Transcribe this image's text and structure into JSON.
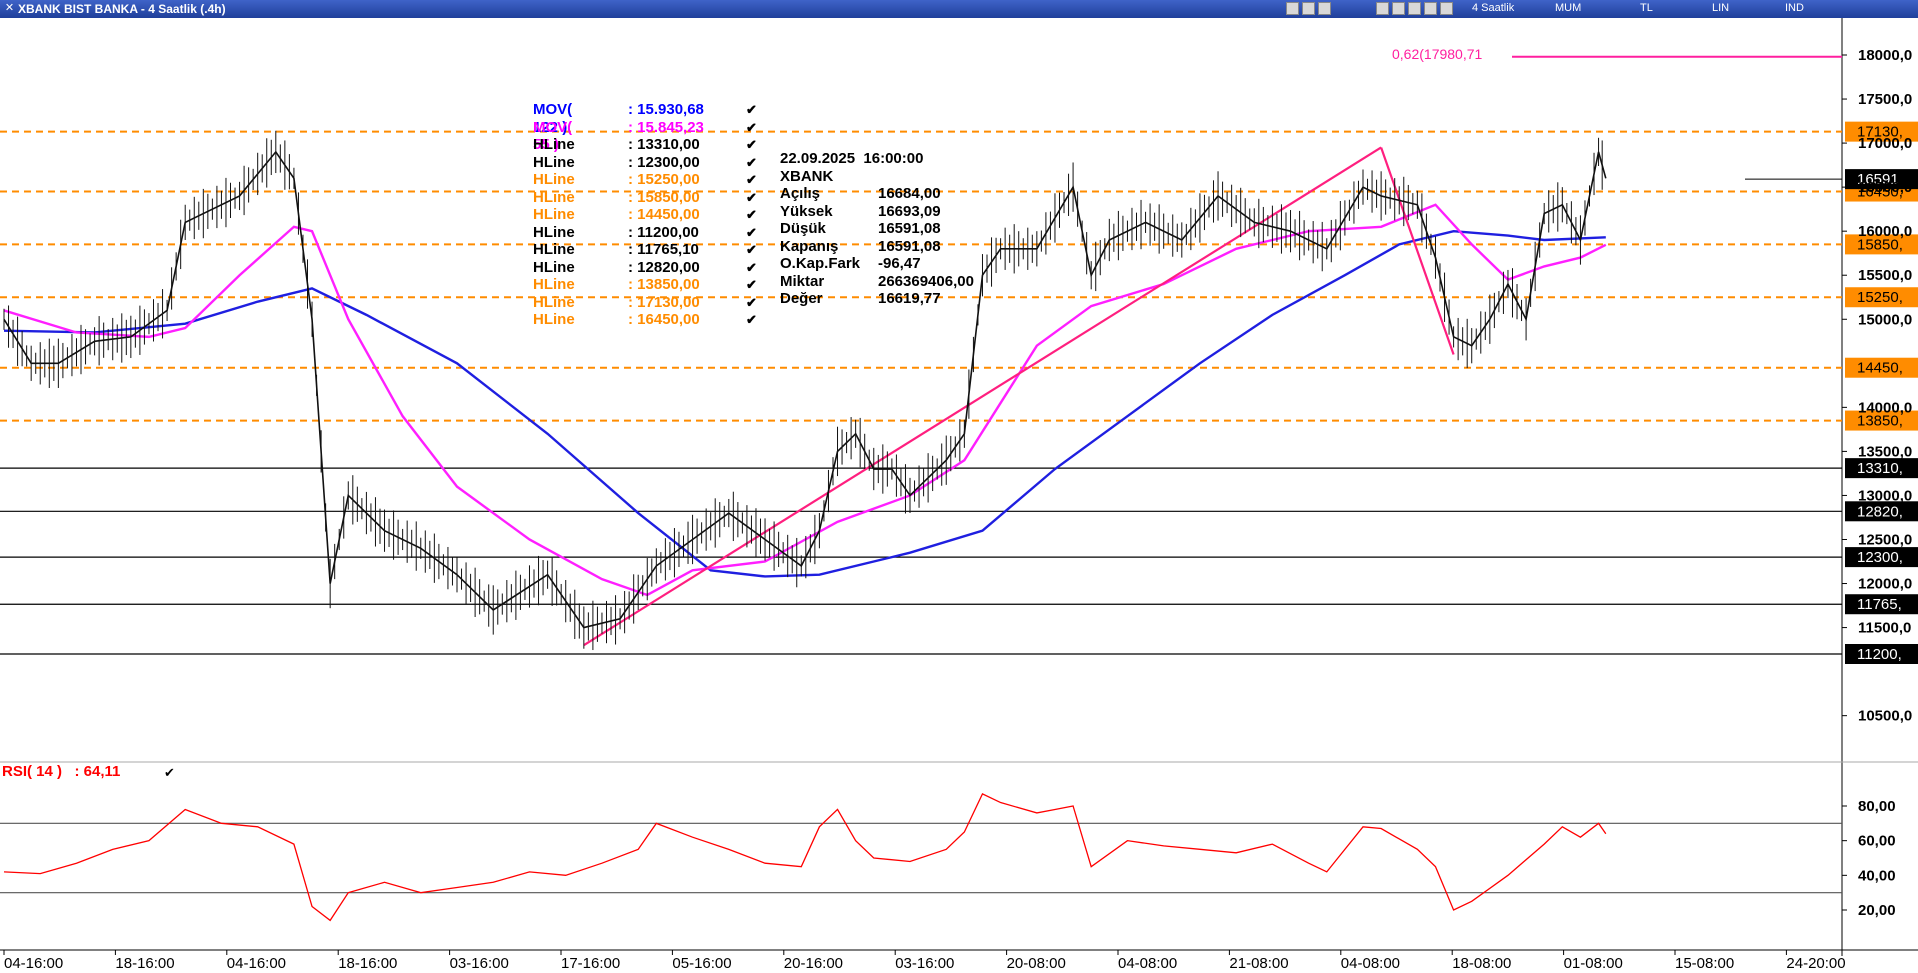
{
  "window": {
    "title": "XBANK BIST BANKA - 4 Saatlik (.4h)",
    "toolbar": {
      "period": "4 Saatlik",
      "chart_type": "MUM",
      "currency": "TL",
      "scale": "LIN",
      "mode": "IND"
    }
  },
  "legend": [
    {
      "name": "MOV( 122 )",
      "value": ": 15.930,68",
      "color": "#0000ff"
    },
    {
      "name": "MOV( 55 )",
      "value": ": 15.845,23",
      "color": "#ff00ff"
    },
    {
      "name": "HLine",
      "value": ": 13310,00",
      "color": "#000000"
    },
    {
      "name": "HLine",
      "value": ": 12300,00",
      "color": "#000000"
    },
    {
      "name": "HLine",
      "value": ": 15250,00",
      "color": "#ff8c00"
    },
    {
      "name": "HLine",
      "value": ": 15850,00",
      "color": "#ff8c00"
    },
    {
      "name": "HLine",
      "value": ": 14450,00",
      "color": "#ff8c00"
    },
    {
      "name": "HLine",
      "value": ": 11200,00",
      "color": "#000000"
    },
    {
      "name": "HLine",
      "value": ": 11765,10",
      "color": "#000000"
    },
    {
      "name": "HLine",
      "value": ": 12820,00",
      "color": "#000000"
    },
    {
      "name": "HLine",
      "value": ": 13850,00",
      "color": "#ff8c00"
    },
    {
      "name": "HLine",
      "value": ": 17130,00",
      "color": "#ff8c00"
    },
    {
      "name": "HLine",
      "value": ": 16450,00",
      "color": "#ff8c00"
    }
  ],
  "info_box": {
    "datetime": "22.09.2025  16:00:00",
    "symbol": "XBANK",
    "rows": [
      {
        "label": "Açılış",
        "value": "16684,00"
      },
      {
        "label": "Yüksek",
        "value": "16693,09"
      },
      {
        "label": "Düşük",
        "value": "16591,08"
      },
      {
        "label": "Kapanış",
        "value": "16591,08"
      },
      {
        "label": "O.Kap.Fark",
        "value": "-96,47"
      },
      {
        "label": "Miktar",
        "value": "266369406,00"
      },
      {
        "label": "Değer",
        "value": "16619,77"
      }
    ]
  },
  "fib_label": "0,62(17980,71",
  "rsi_label": "RSI( 14 )   : 64,11",
  "chart_data": {
    "type": "line",
    "title": "XBANK BIST BANKA - 4 Saatlik (.4h)",
    "price_axis": {
      "ticks": [
        "18000,0",
        "17500,0",
        "17000,0",
        "16500,0",
        "16000,0",
        "15500,0",
        "15000,0",
        "14000,0",
        "13500,0",
        "13000,0",
        "12500,0",
        "12000,0",
        "11500,0",
        "10500,0"
      ],
      "range": [
        10200,
        18150
      ]
    },
    "x_labels": [
      "04-16:00",
      "18-16:00",
      "04-16:00",
      "18-16:00",
      "03-16:00",
      "17-16:00",
      "05-16:00",
      "20-16:00",
      "03-16:00",
      "20-08:00",
      "04-08:00",
      "21-08:00",
      "04-08:00",
      "18-08:00",
      "01-08:00",
      "15-08:00",
      "24-20:00"
    ],
    "hlines": [
      {
        "value": 17130,
        "label": "17130,",
        "style": "dashed",
        "color": "#ff8c00"
      },
      {
        "value": 16450,
        "label": "16450,",
        "style": "dashed",
        "color": "#ff8c00"
      },
      {
        "value": 15850,
        "label": "15850,",
        "style": "dashed",
        "color": "#ff8c00"
      },
      {
        "value": 15250,
        "label": "15250,",
        "style": "dashed",
        "color": "#ff8c00"
      },
      {
        "value": 14450,
        "label": "14450,",
        "style": "dashed",
        "color": "#ff8c00"
      },
      {
        "value": 13850,
        "label": "13850,",
        "style": "dashed",
        "color": "#ff8c00"
      },
      {
        "value": 13310,
        "label": "13310,",
        "style": "solid",
        "color": "#000000"
      },
      {
        "value": 12820,
        "label": "12820,",
        "style": "solid",
        "color": "#000000"
      },
      {
        "value": 12300,
        "label": "12300,",
        "style": "solid",
        "color": "#000000"
      },
      {
        "value": 11765,
        "label": "11765,",
        "style": "solid",
        "color": "#000000"
      },
      {
        "value": 11200,
        "label": "11200,",
        "style": "solid",
        "color": "#000000"
      }
    ],
    "last_price": {
      "value": 16591,
      "label": "16591"
    },
    "fib_level": {
      "value": 17980.71
    },
    "price_series": [
      {
        "x": 0,
        "y": 15000
      },
      {
        "x": 1.5,
        "y": 14500
      },
      {
        "x": 3,
        "y": 14500
      },
      {
        "x": 5,
        "y": 14750
      },
      {
        "x": 7,
        "y": 14800
      },
      {
        "x": 9,
        "y": 15100
      },
      {
        "x": 10,
        "y": 16100
      },
      {
        "x": 11,
        "y": 16200
      },
      {
        "x": 13,
        "y": 16400
      },
      {
        "x": 15,
        "y": 16900
      },
      {
        "x": 16,
        "y": 16600
      },
      {
        "x": 17,
        "y": 15000
      },
      {
        "x": 18,
        "y": 12000
      },
      {
        "x": 19,
        "y": 13000
      },
      {
        "x": 21,
        "y": 12600
      },
      {
        "x": 23,
        "y": 12400
      },
      {
        "x": 25,
        "y": 12100
      },
      {
        "x": 27,
        "y": 11700
      },
      {
        "x": 30,
        "y": 12100
      },
      {
        "x": 32,
        "y": 11500
      },
      {
        "x": 34,
        "y": 11600
      },
      {
        "x": 36,
        "y": 12200
      },
      {
        "x": 38,
        "y": 12500
      },
      {
        "x": 40,
        "y": 12800
      },
      {
        "x": 42,
        "y": 12500
      },
      {
        "x": 44,
        "y": 12200
      },
      {
        "x": 45,
        "y": 12600
      },
      {
        "x": 46,
        "y": 13500
      },
      {
        "x": 47,
        "y": 13700
      },
      {
        "x": 48,
        "y": 13300
      },
      {
        "x": 49,
        "y": 13300
      },
      {
        "x": 50,
        "y": 13000
      },
      {
        "x": 52,
        "y": 13400
      },
      {
        "x": 53,
        "y": 13700
      },
      {
        "x": 54,
        "y": 15500
      },
      {
        "x": 55,
        "y": 15800
      },
      {
        "x": 57,
        "y": 15800
      },
      {
        "x": 59,
        "y": 16500
      },
      {
        "x": 60,
        "y": 15500
      },
      {
        "x": 61,
        "y": 15900
      },
      {
        "x": 63,
        "y": 16100
      },
      {
        "x": 65,
        "y": 15900
      },
      {
        "x": 67,
        "y": 16400
      },
      {
        "x": 69,
        "y": 16100
      },
      {
        "x": 71,
        "y": 16000
      },
      {
        "x": 73,
        "y": 15800
      },
      {
        "x": 75,
        "y": 16500
      },
      {
        "x": 76,
        "y": 16400
      },
      {
        "x": 78,
        "y": 16300
      },
      {
        "x": 79,
        "y": 15700
      },
      {
        "x": 80,
        "y": 14800
      },
      {
        "x": 81,
        "y": 14700
      },
      {
        "x": 82,
        "y": 15000
      },
      {
        "x": 83,
        "y": 15400
      },
      {
        "x": 84,
        "y": 15000
      },
      {
        "x": 85,
        "y": 16200
      },
      {
        "x": 86,
        "y": 16300
      },
      {
        "x": 87,
        "y": 15900
      },
      {
        "x": 88,
        "y": 16900
      },
      {
        "x": 88.4,
        "y": 16600
      }
    ],
    "series": [
      {
        "name": "MOV( 122 )",
        "color": "#1f1fe0",
        "values": [
          {
            "x": 0,
            "y": 14870
          },
          {
            "x": 5,
            "y": 14850
          },
          {
            "x": 10,
            "y": 14950
          },
          {
            "x": 14,
            "y": 15200
          },
          {
            "x": 17,
            "y": 15350
          },
          {
            "x": 20,
            "y": 15050
          },
          {
            "x": 25,
            "y": 14500
          },
          {
            "x": 30,
            "y": 13700
          },
          {
            "x": 35,
            "y": 12800
          },
          {
            "x": 39,
            "y": 12150
          },
          {
            "x": 42,
            "y": 12080
          },
          {
            "x": 45,
            "y": 12100
          },
          {
            "x": 50,
            "y": 12350
          },
          {
            "x": 54,
            "y": 12600
          },
          {
            "x": 58,
            "y": 13300
          },
          {
            "x": 62,
            "y": 13900
          },
          {
            "x": 66,
            "y": 14500
          },
          {
            "x": 70,
            "y": 15050
          },
          {
            "x": 74,
            "y": 15500
          },
          {
            "x": 77,
            "y": 15850
          },
          {
            "x": 80,
            "y": 16000
          },
          {
            "x": 83,
            "y": 15950
          },
          {
            "x": 85,
            "y": 15900
          },
          {
            "x": 88.4,
            "y": 15930
          }
        ]
      },
      {
        "name": "MOV( 55 )",
        "color": "#ff1fff",
        "values": [
          {
            "x": 0,
            "y": 15100
          },
          {
            "x": 4,
            "y": 14850
          },
          {
            "x": 8,
            "y": 14800
          },
          {
            "x": 10,
            "y": 14900
          },
          {
            "x": 13,
            "y": 15500
          },
          {
            "x": 16,
            "y": 16050
          },
          {
            "x": 17,
            "y": 16000
          },
          {
            "x": 19,
            "y": 15000
          },
          {
            "x": 22,
            "y": 13900
          },
          {
            "x": 25,
            "y": 13100
          },
          {
            "x": 29,
            "y": 12500
          },
          {
            "x": 33,
            "y": 12050
          },
          {
            "x": 35.5,
            "y": 11870
          },
          {
            "x": 38,
            "y": 12150
          },
          {
            "x": 42,
            "y": 12250
          },
          {
            "x": 46,
            "y": 12700
          },
          {
            "x": 50,
            "y": 13000
          },
          {
            "x": 53,
            "y": 13400
          },
          {
            "x": 55,
            "y": 14050
          },
          {
            "x": 57,
            "y": 14700
          },
          {
            "x": 60,
            "y": 15150
          },
          {
            "x": 64,
            "y": 15400
          },
          {
            "x": 68,
            "y": 15800
          },
          {
            "x": 72,
            "y": 16000
          },
          {
            "x": 76,
            "y": 16050
          },
          {
            "x": 79,
            "y": 16300
          },
          {
            "x": 81,
            "y": 15850
          },
          {
            "x": 83,
            "y": 15450
          },
          {
            "x": 85,
            "y": 15600
          },
          {
            "x": 87,
            "y": 15700
          },
          {
            "x": 88.4,
            "y": 15845
          }
        ]
      }
    ],
    "trendlines": [
      {
        "x1": 32,
        "y1": 11300,
        "x2": 76,
        "y2": 16950
      },
      {
        "x1": 76,
        "y1": 16950,
        "x2": 80,
        "y2": 14600
      }
    ],
    "rsi": {
      "name": "RSI( 14 )",
      "ticks": [
        "80,00",
        "60,00",
        "40,00",
        "20,00"
      ],
      "levels": [
        70,
        30
      ],
      "range": [
        5,
        95
      ],
      "values": [
        {
          "x": 0,
          "y": 42
        },
        {
          "x": 2,
          "y": 41
        },
        {
          "x": 4,
          "y": 47
        },
        {
          "x": 6,
          "y": 55
        },
        {
          "x": 8,
          "y": 60
        },
        {
          "x": 10,
          "y": 78
        },
        {
          "x": 12,
          "y": 70
        },
        {
          "x": 14,
          "y": 68
        },
        {
          "x": 16,
          "y": 58
        },
        {
          "x": 17,
          "y": 22
        },
        {
          "x": 18,
          "y": 14
        },
        {
          "x": 19,
          "y": 30
        },
        {
          "x": 21,
          "y": 36
        },
        {
          "x": 23,
          "y": 30
        },
        {
          "x": 25,
          "y": 33
        },
        {
          "x": 27,
          "y": 36
        },
        {
          "x": 29,
          "y": 42
        },
        {
          "x": 31,
          "y": 40
        },
        {
          "x": 33,
          "y": 47
        },
        {
          "x": 35,
          "y": 55
        },
        {
          "x": 36,
          "y": 70
        },
        {
          "x": 38,
          "y": 62
        },
        {
          "x": 40,
          "y": 55
        },
        {
          "x": 42,
          "y": 47
        },
        {
          "x": 44,
          "y": 45
        },
        {
          "x": 45,
          "y": 68
        },
        {
          "x": 46,
          "y": 78
        },
        {
          "x": 47,
          "y": 60
        },
        {
          "x": 48,
          "y": 50
        },
        {
          "x": 50,
          "y": 48
        },
        {
          "x": 52,
          "y": 55
        },
        {
          "x": 53,
          "y": 65
        },
        {
          "x": 54,
          "y": 87
        },
        {
          "x": 55,
          "y": 82
        },
        {
          "x": 57,
          "y": 76
        },
        {
          "x": 58,
          "y": 78
        },
        {
          "x": 59,
          "y": 80
        },
        {
          "x": 60,
          "y": 45
        },
        {
          "x": 62,
          "y": 60
        },
        {
          "x": 64,
          "y": 57
        },
        {
          "x": 66,
          "y": 55
        },
        {
          "x": 68,
          "y": 53
        },
        {
          "x": 70,
          "y": 58
        },
        {
          "x": 72,
          "y": 47
        },
        {
          "x": 73,
          "y": 42
        },
        {
          "x": 75,
          "y": 68
        },
        {
          "x": 76,
          "y": 67
        },
        {
          "x": 78,
          "y": 55
        },
        {
          "x": 79,
          "y": 45
        },
        {
          "x": 80,
          "y": 20
        },
        {
          "x": 81,
          "y": 25
        },
        {
          "x": 83,
          "y": 40
        },
        {
          "x": 85,
          "y": 58
        },
        {
          "x": 86,
          "y": 68
        },
        {
          "x": 87,
          "y": 62
        },
        {
          "x": 88,
          "y": 70
        },
        {
          "x": 88.4,
          "y": 64
        }
      ]
    }
  }
}
